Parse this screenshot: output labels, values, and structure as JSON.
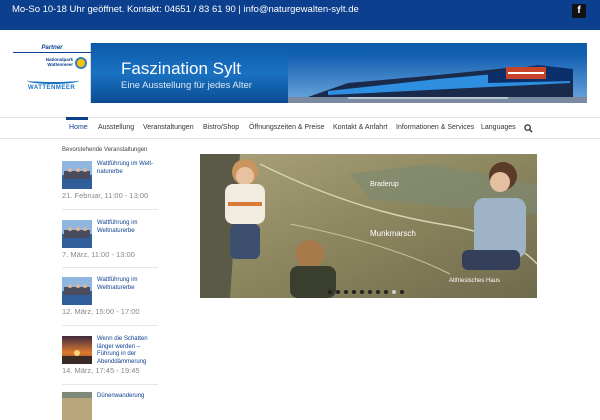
{
  "topbar": {
    "contact_text": "Mo-So 10-18 Uhr geöffnet. Kontakt: 04651 / 83 61 90 | info@naturgewalten-sylt.de",
    "facebook_icon": "facebook-icon"
  },
  "banner": {
    "partner_label": "Partner",
    "partner_np": "Nationalpark Wattenmeer",
    "partner_ww": "WATTENMEER",
    "title": "Faszination Sylt",
    "subtitle": "Eine Ausstellung für jedes Alter"
  },
  "nav": {
    "items": [
      {
        "label": "Home",
        "active": true
      },
      {
        "label": "Ausstellung"
      },
      {
        "label": "Veranstaltungen"
      },
      {
        "label": "Bistro/Shop"
      },
      {
        "label": "Öffnungszeiten & Preise"
      },
      {
        "label": "Kontakt & Anfahrt"
      },
      {
        "label": "Informationen & Services"
      },
      {
        "label": "Languages"
      }
    ],
    "search_icon": "search-icon"
  },
  "sidebar": {
    "heading": "Bevorstehende Veranstaltungen",
    "events": [
      {
        "title": "Wattführung im Welt­naturerbe",
        "date": "21. Februar, 11:00 - 13:00"
      },
      {
        "title": "Wattführung im Weltnaturerbe",
        "date": "7. März, 11:00 - 13:00"
      },
      {
        "title": "Wattführung im Weltnaturerbe",
        "date": "12. März, 15:00 - 17:00"
      },
      {
        "title": "Wenn die Schatten länger werden – Führung in der Abenddämmerung",
        "date": "14. März, 17:45 - 19:45"
      },
      {
        "title": "Dünenwanderung",
        "date": ""
      }
    ]
  },
  "slider": {
    "map_labels": [
      "Braderup",
      "Munkmarsch",
      "Altfriesisches Haus"
    ],
    "slide_count": 10,
    "active_slide": 8
  },
  "colors": {
    "brand_blue": "#0c3f8d",
    "banner_blue": "#1a72c2",
    "text_gray": "#888888"
  }
}
